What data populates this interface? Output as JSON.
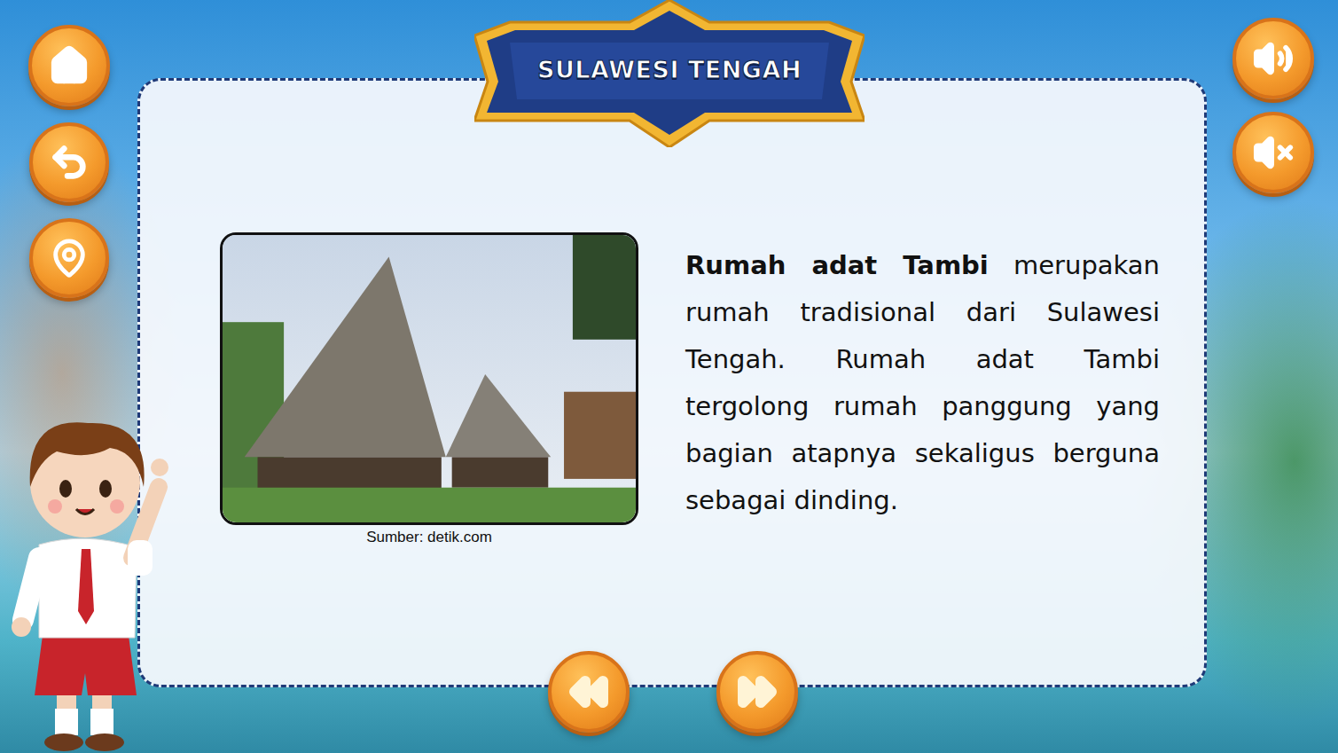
{
  "title": "SULAWESI TENGAH",
  "content": {
    "image_caption": "Sumber: detik.com",
    "paragraph": [
      {
        "text": "Rumah adat Tambi",
        "kind": "bold"
      },
      {
        "text": " merupakan rumah tradisional dari Sulawesi Tengah. Rumah adat Tambi tergolong rumah panggung yang bagian atapnya sekaligus berguna sebagai dinding.",
        "kind": "normal"
      }
    ]
  }
}
